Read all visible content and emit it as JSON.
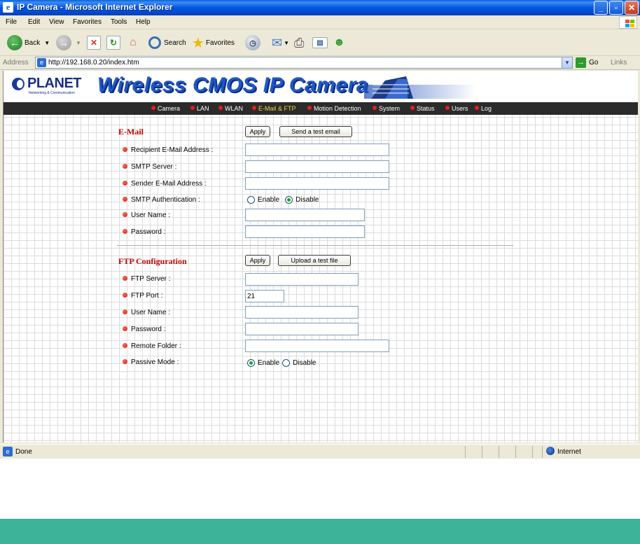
{
  "window": {
    "title": "IP Camera - Microsoft Internet Explorer"
  },
  "menu": [
    "File",
    "Edit",
    "View",
    "Favorites",
    "Tools",
    "Help"
  ],
  "toolbar": {
    "back_label": "Back",
    "search_label": "Search",
    "favorites_label": "Favorites"
  },
  "address": {
    "label": "Address",
    "url": "http://192.168.0.20/index.htm",
    "go_label": "Go",
    "links_label": "Links"
  },
  "banner": {
    "logo_text": "PLANET",
    "logo_sub": "Networking & Communication",
    "headline": "Wireless CMOS IP Camera"
  },
  "nav": {
    "items": [
      "Camera",
      "LAN",
      "WLAN",
      "E-Mail & FTP",
      "Motion Detection",
      "System",
      "Status",
      "Users",
      "Log"
    ],
    "active": "E-Mail & FTP"
  },
  "email": {
    "title": "E-Mail",
    "apply_label": "Apply",
    "test_label": "Send a test email",
    "fields": {
      "recipient_label": "Recipient E-Mail Address :",
      "recipient_value": "",
      "smtp_server_label": "SMTP Server :",
      "smtp_server_value": "",
      "sender_label": "Sender E-Mail Address :",
      "sender_value": "",
      "smtp_auth_label": "SMTP Authentication :",
      "smtp_auth_enable": "Enable",
      "smtp_auth_disable": "Disable",
      "smtp_auth_selected": "Disable",
      "username_label": "User Name :",
      "username_value": "",
      "password_label": "Password :",
      "password_value": ""
    }
  },
  "ftp": {
    "title": "FTP Configuration",
    "apply_label": "Apply",
    "test_label": "Upload a test file",
    "fields": {
      "server_label": "FTP Server :",
      "server_value": "",
      "port_label": "FTP Port :",
      "port_value": "21",
      "username_label": "User Name :",
      "username_value": "",
      "password_label": "Password :",
      "password_value": "",
      "folder_label": "Remote Folder :",
      "folder_value": "",
      "passive_label": "Passive Mode :",
      "passive_enable": "Enable",
      "passive_disable": "Disable",
      "passive_selected": "Enable"
    }
  },
  "status": {
    "text": "Done",
    "zone": "Internet"
  },
  "colors": {
    "title_bar": "#0055e5",
    "section_title": "#c00000",
    "nav_bg": "#2b2b2b",
    "nav_active": "#f6d040",
    "headline": "#1e56c8",
    "footer_band": "#3db39a"
  }
}
